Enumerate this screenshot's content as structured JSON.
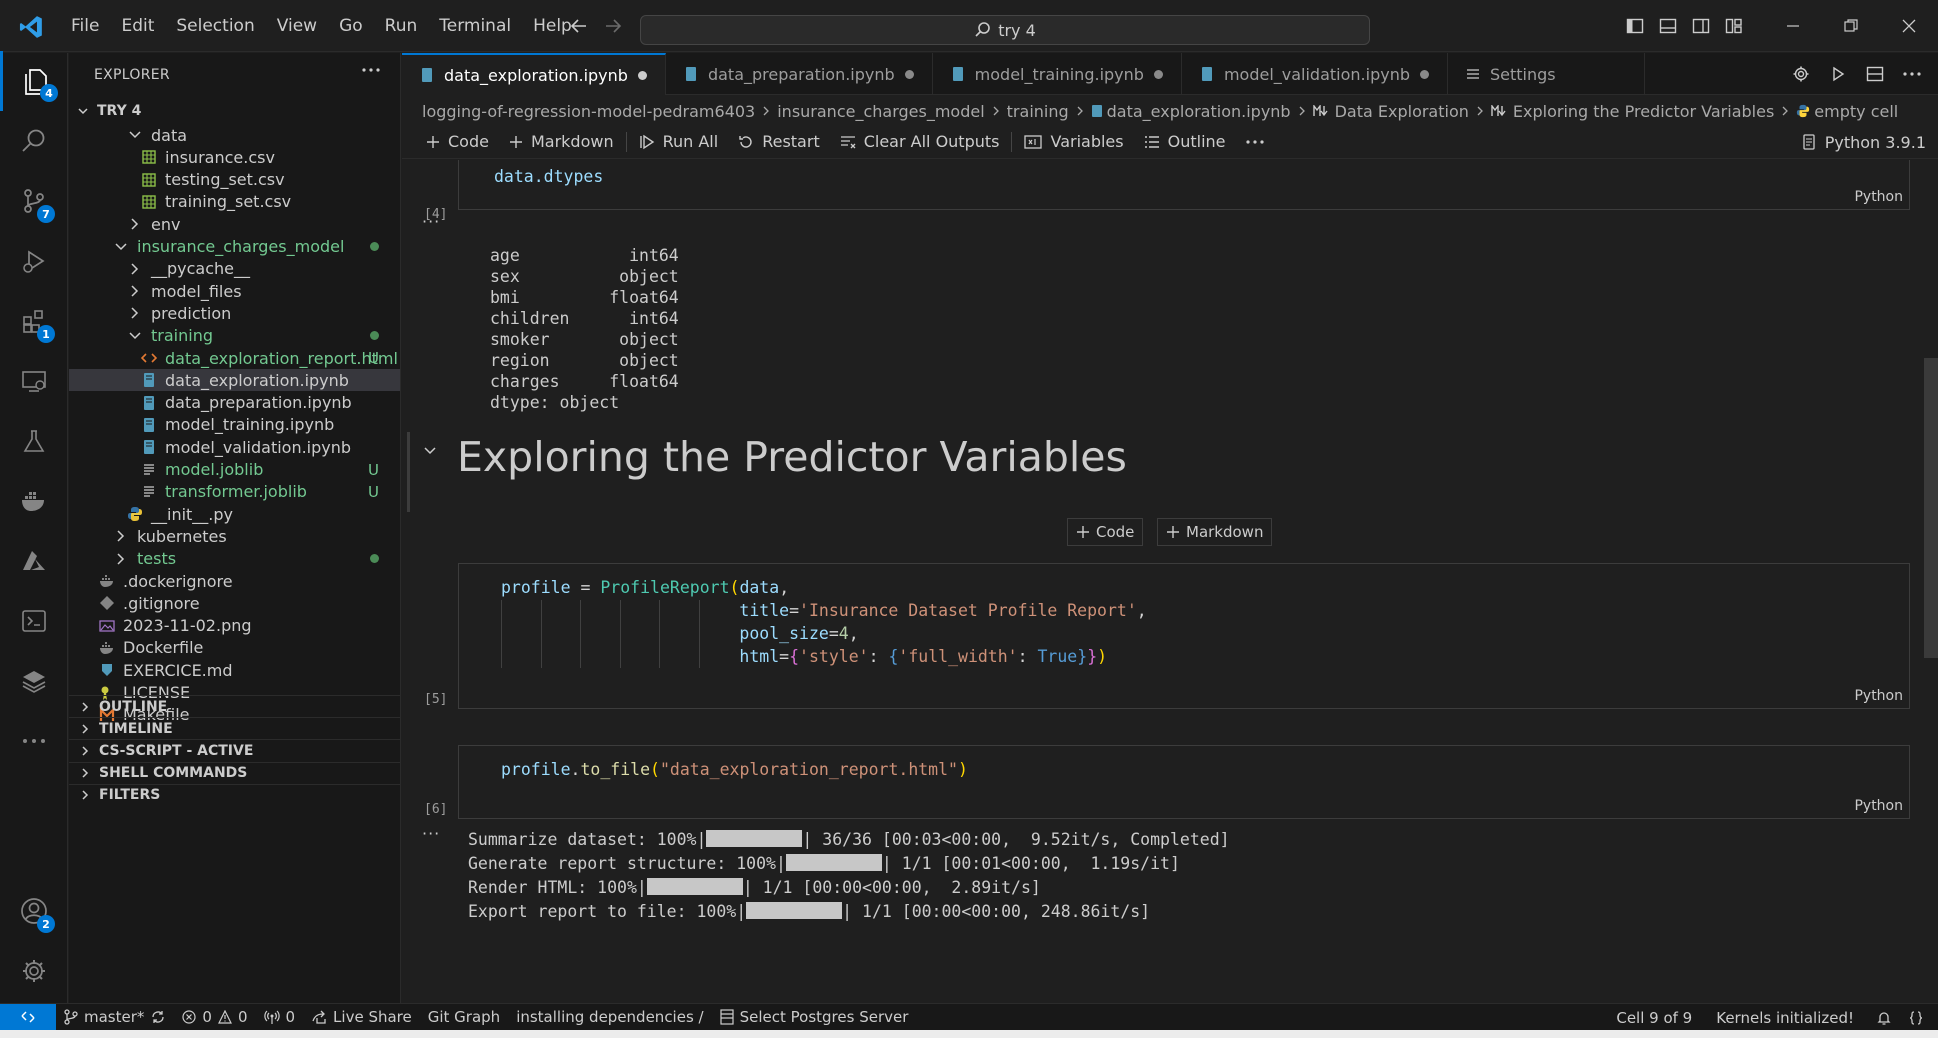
{
  "menu": [
    "File",
    "Edit",
    "Selection",
    "View",
    "Go",
    "Run",
    "Terminal",
    "Help"
  ],
  "command_center": {
    "text": "try 4"
  },
  "activity_badges": {
    "explorer": "4",
    "source_control": "7",
    "extensions": "1",
    "accounts": "2"
  },
  "explorer": {
    "title": "EXPLORER",
    "root": "TRY 4",
    "items": [
      {
        "label": "data",
        "type": "folder-open",
        "indent": 1
      },
      {
        "label": "insurance.csv",
        "type": "csv",
        "indent": 2
      },
      {
        "label": "testing_set.csv",
        "type": "csv",
        "indent": 2
      },
      {
        "label": "training_set.csv",
        "type": "csv",
        "indent": 2
      },
      {
        "label": "env",
        "type": "folder",
        "indent": 1
      },
      {
        "label": "insurance_charges_model",
        "type": "folder-open",
        "indent": 0,
        "color": "#73c991",
        "dot": true
      },
      {
        "label": "__pycache__",
        "type": "folder",
        "indent": 1
      },
      {
        "label": "model_files",
        "type": "folder",
        "indent": 1
      },
      {
        "label": "prediction",
        "type": "folder",
        "indent": 1
      },
      {
        "label": "training",
        "type": "folder-open",
        "indent": 1,
        "color": "#73c991",
        "dot": true
      },
      {
        "label": "data_exploration_report.html",
        "type": "html",
        "indent": 2,
        "color": "#73c991",
        "status": "U"
      },
      {
        "label": "data_exploration.ipynb",
        "type": "notebook",
        "indent": 2,
        "selected": true
      },
      {
        "label": "data_preparation.ipynb",
        "type": "notebook",
        "indent": 2
      },
      {
        "label": "model_training.ipynb",
        "type": "notebook",
        "indent": 2
      },
      {
        "label": "model_validation.ipynb",
        "type": "notebook",
        "indent": 2
      },
      {
        "label": "model.joblib",
        "type": "text",
        "indent": 2,
        "color": "#73c991",
        "status": "U"
      },
      {
        "label": "transformer.joblib",
        "type": "text",
        "indent": 2,
        "color": "#73c991",
        "status": "U"
      },
      {
        "label": "__init__.py",
        "type": "python",
        "indent": 1
      },
      {
        "label": "kubernetes",
        "type": "folder",
        "indent": 0
      },
      {
        "label": "tests",
        "type": "folder",
        "indent": 0,
        "color": "#73c991",
        "dot": true
      },
      {
        "label": ".dockerignore",
        "type": "docker",
        "indent": -1
      },
      {
        "label": ".gitignore",
        "type": "git",
        "indent": -1
      },
      {
        "label": "2023-11-02.png",
        "type": "image",
        "indent": -1
      },
      {
        "label": "Dockerfile",
        "type": "docker",
        "indent": -1
      },
      {
        "label": "EXERCICE.md",
        "type": "markdown",
        "indent": -1
      },
      {
        "label": "LICENSE",
        "type": "license",
        "indent": -1
      },
      {
        "label": "Makefile",
        "type": "makefile",
        "indent": -1
      }
    ],
    "sections": [
      "OUTLINE",
      "TIMELINE",
      "CS-SCRIPT - ACTIVE",
      "SHELL COMMANDS",
      "FILTERS"
    ]
  },
  "tabs": [
    {
      "label": "data_exploration.ipynb",
      "active": true
    },
    {
      "label": "data_preparation.ipynb"
    },
    {
      "label": "model_training.ipynb"
    },
    {
      "label": "model_validation.ipynb"
    },
    {
      "label": "Settings"
    }
  ],
  "breadcrumb": [
    "logging-of-regression-model-pedram6403",
    "insurance_charges_model",
    "training",
    "data_exploration.ipynb",
    "Data Exploration",
    "Exploring the Predictor Variables",
    "empty cell"
  ],
  "notebook_toolbar": {
    "code": "Code",
    "markdown": "Markdown",
    "run_all": "Run All",
    "restart": "Restart",
    "clear": "Clear All Outputs",
    "variables": "Variables",
    "outline": "Outline",
    "kernel": "Python 3.9.1"
  },
  "cells": {
    "c4": {
      "exec": "[4]",
      "code": "data.dtypes",
      "lang": "Python"
    },
    "c4_output": [
      "age           int64",
      "sex          object",
      "bmi         float64",
      "children      int64",
      "smoker       object",
      "region       object",
      "charges     float64",
      "dtype: object"
    ],
    "markdown_heading": "Exploring the Predictor Variables",
    "insert_code": "Code",
    "insert_markdown": "Markdown",
    "c5": {
      "exec": "[5]",
      "lang": "Python"
    },
    "c6": {
      "exec": "[6]",
      "lang": "Python"
    },
    "c6_output": [
      {
        "label": "Summarize dataset: 100%|",
        "tail": "| 36/36 [00:03<00:00,  9.52it/s, Completed]"
      },
      {
        "label": "Generate report structure: 100%|",
        "tail": "| 1/1 [00:01<00:00,  1.19s/it]"
      },
      {
        "label": "Render HTML: 100%|",
        "tail": "| 1/1 [00:00<00:00,  2.89it/s]"
      },
      {
        "label": "Export report to file: 100%|",
        "tail": "| 1/1 [00:00<00:00, 248.86it/s]"
      }
    ]
  },
  "status_bar": {
    "branch": "master*",
    "errors": "0",
    "warnings": "0",
    "ports": "0",
    "live_share": "Live Share",
    "git_graph": "Git Graph",
    "deps": "installing dependencies /",
    "postgres": "Select Postgres Server",
    "cell": "Cell 9 of 9",
    "kernels": "Kernels initialized!"
  }
}
